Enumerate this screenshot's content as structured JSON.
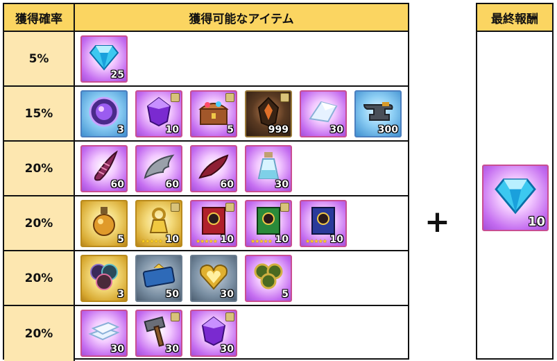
{
  "table": {
    "header": {
      "rate": "獲得確率",
      "items": "獲得可能なアイテム"
    },
    "rows": [
      {
        "rate": "5%",
        "items": [
          {
            "icon": "blue-crystal-gem-icon",
            "qty": "25"
          }
        ]
      },
      {
        "rate": "15%",
        "items": [
          {
            "icon": "cosmic-orb-icon",
            "qty": "3"
          },
          {
            "icon": "purple-gem-icon",
            "qty": "10"
          },
          {
            "icon": "treasure-chest-icon",
            "qty": "5"
          },
          {
            "icon": "dark-ore-icon",
            "qty": "999"
          },
          {
            "icon": "crystal-shard-icon",
            "qty": "30"
          },
          {
            "icon": "anvil-icon",
            "qty": "300"
          }
        ]
      },
      {
        "rate": "20%",
        "items": [
          {
            "icon": "spiral-horn-icon",
            "qty": "60"
          },
          {
            "icon": "wing-icon",
            "qty": "60"
          },
          {
            "icon": "red-feather-icon",
            "qty": "60"
          },
          {
            "icon": "potion-bottle-icon",
            "qty": "30"
          }
        ]
      },
      {
        "rate": "20%",
        "items": [
          {
            "icon": "elixir-flask-icon",
            "qty": "5"
          },
          {
            "icon": "gold-key-charm-icon",
            "qty": "10",
            "stars": "★★★★★"
          },
          {
            "icon": "red-spellbook-icon",
            "qty": "10",
            "stars": "★★★★★"
          },
          {
            "icon": "green-spellbook-icon",
            "qty": "10",
            "stars": "★★★★★"
          },
          {
            "icon": "blue-spellbook-icon",
            "qty": "10",
            "stars": "★★★★★"
          }
        ]
      },
      {
        "rate": "20%",
        "items": [
          {
            "icon": "rainbow-orbs-icon",
            "qty": "3"
          },
          {
            "icon": "ticket-icon",
            "qty": "50"
          },
          {
            "icon": "golden-heart-icon",
            "qty": "30"
          },
          {
            "icon": "green-coins-icon",
            "qty": "5"
          }
        ]
      },
      {
        "rate": "20%",
        "items": [
          {
            "icon": "silver-ingots-icon",
            "qty": "30"
          },
          {
            "icon": "hammer-icon",
            "qty": "30"
          },
          {
            "icon": "violet-gem-icon",
            "qty": "30"
          }
        ]
      }
    ]
  },
  "plus_sign": "+",
  "final_reward": {
    "header": "最終報酬",
    "item": {
      "icon": "blue-crystal-gem-icon",
      "qty": "10"
    }
  }
}
